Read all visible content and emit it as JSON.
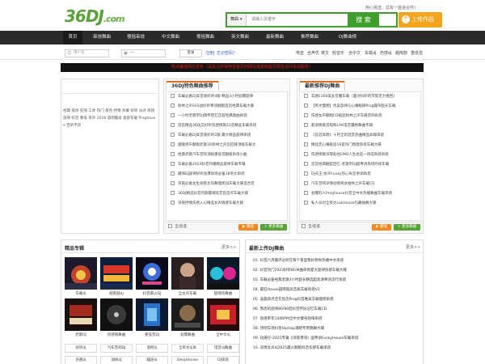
{
  "header": {
    "logo_main": "36DJ",
    "logo_suffix": ".com",
    "welcome": "用心挑选，总有一首适合你！",
    "search_select": "舞曲",
    "search_placeholder": "请输入关键字",
    "search_button": "搜 索",
    "upload_button": "上传作品"
  },
  "nav": [
    "首页",
    "串烧舞曲",
    "慢摇串烧",
    "中文舞曲",
    "慢摇舞曲",
    "英文舞曲",
    "最新舞曲",
    "推荐舞曲",
    "DJ舞曲榜"
  ],
  "login": {
    "username_placeholder": "用户名",
    "password_placeholder": "••",
    "login_link": "登录",
    "register_link": "注册",
    "forgot_link": "忘记密码?",
    "quick_links": [
      "电音",
      "全声优",
      "英文",
      "轻音乐",
      "全中文",
      "车载dj",
      "伤感dj",
      "越南鼓",
      "重低音"
    ]
  },
  "banner": "热点推送网址发布（请关注并保存在首页的网址或复制首页网址访问本站服务）",
  "left_tags": "经典 夜场 狂嗨 工体 热门 夜色 抒情 热舞 好听 派对 串烧 旋律 抖音 重低 英声 2018 酒吧蹦迪 发烧车载 Proghouse 百听不厌",
  "special": {
    "title": "36DJ特色舞曲推荐",
    "items": [
      "车载必备DJ高音质好听4版-精品3小时劲爆旋律",
      "粉林之声SSS战好听粤语翻唱首首经典车载大碟",
      "一小时老歌劳DJ情怀回忆首首经典歌曲串烧",
      "首首精品36DJ又好听伤感情歌22首精品车载串烧",
      "车载必备DJ高音质好听2版-最大精品旋律串烧",
      "烟嗓男声翻唱老歌3D粉林之声迈巴赫顶级车载大",
      "经典老歌汽车音响顶级重低音翻版串烧小曲",
      "车载必备2023抖音热播精品旋律车载专辑",
      "最嗨DJ旋律好听劲爆串烧必备38英文串烧",
      "深夜必备女生剥夜太热舞慢摇DJ车载大碟混合音",
      "36DJ精选抖音热歌最嗨炫音首首点车载大碟",
      "深夜抒情伤感入心精选女声情感车载大碟"
    ],
    "select_all": "全/反选",
    "play_btn": "播放",
    "more_btn": "+ 更多舞曲"
  },
  "recommend": {
    "title": "最新推荐DJ舞曲",
    "items": [
      "奔驰E300美女音魔车载（面对抖听的荧炼无力挽回)",
      "【英文慢摇】优美旋律沁心睡眠踩Prog蹦窄超长车载",
      "伤感女声翻唱CD级品粉林之声车载音响串烧",
      "超浪情歌首唱和LAK电音疆绝舞曲专辑",
      "《首首高燃》十月全新混音热曲精品高端串烧",
      "精品无心睡眠追18首热门情歌串烧车载大碟",
      "伤感情歌深夜助往EMO人生总是一场成串烧串烧",
      "首首经典翻是回忆-老歌带DJ超粤语串烧时尚车载",
      "DJ天王-女声Funky伤心失恋男调串烧",
      "汽车音响深情动情男女柏林之声车载CD",
      "劲爆的人Proghouse抖音全中文热播舞曲车载串烧",
      "私人派对全英文LakHouse包藏抛舞大碟"
    ],
    "select_all": "全/反选",
    "play_btn": "播放",
    "more_btn": "+ 更多舞曲"
  },
  "albums": {
    "title": "精品专辑",
    "more": "更多>>",
    "row1": [
      "车载dj",
      "越南鼓dj",
      "抖音最火DJ",
      "全女声车载",
      "超嗨热舞曲"
    ],
    "row2": [
      "老歌DJ",
      "伤感情舞曲",
      "重低音DJ",
      "劲爆舞曲",
      "全中文dj"
    ],
    "row3": [
      "好听dj",
      "汽车音响DJ",
      "酒吧dj",
      "全英文dj串",
      "电音dj舞曲"
    ],
    "row4": [
      "伤感dj",
      "加快dj",
      "蹦迪dj",
      "DeepHouse",
      "DJ串烧"
    ]
  },
  "newest": {
    "title": "最新上传DJ舞曲",
    "more": "更多>>",
    "items": [
      "01. 抖音六月循环必听在每个夜里我好想你热播中文串烧",
      "02. 抖音热门2023好听BGM曲串衰夏大旋律伤感车载大碟",
      "03. 车载必备经典老歌3小时超长精选超高清粤语流行串烧",
      "04. 最狂House越南鼓高音质车载串烧V2",
      "05. 凌晨四点还在思念Prog抖音唯美车载慢摇串烧",
      "06. 熟悉的旋律80/90后抖音怀旧记忆车载CD",
      "07. 劲感率年140BPM全中文健身劲嗨串烧",
      "08. 顶吧车场抖音HipHop潮吧专用跳舞大碟",
      "09. DJ黄仔-2025专辑《深夜港湾》国粤语FunkyHouse车载串烧",
      "10. 深情女声dj2025最火翻唱抖音伤感车载串烧"
    ]
  },
  "colors": {
    "brand_green": "#3f9f2c",
    "accent_orange": "#f08a21",
    "nav_dark": "#2b2b2b",
    "banner_red": "#e0201b"
  }
}
